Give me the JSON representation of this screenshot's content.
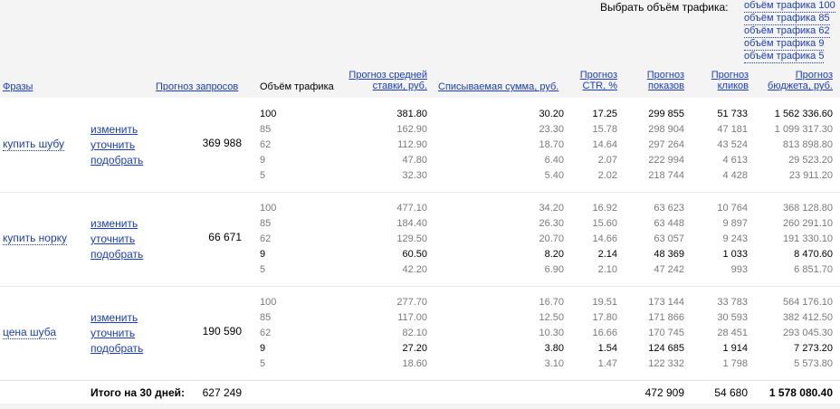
{
  "traffic_select": {
    "label": "Выбрать объём трафика:",
    "options": [
      "объём трафика 100",
      "объём трафика 85",
      "объём трафика 62",
      "объём трафика 9",
      "объём трафика 5"
    ]
  },
  "header": {
    "phrases": "Фразы",
    "requests": "Прогноз запросов",
    "volume": "Объём трафика",
    "bid_l1": "Прогноз средней",
    "bid_l2": "ставки, руб.",
    "charged": "Списываемая сумма, руб.",
    "ctr_l1": "Прогноз",
    "ctr_l2": "CTR, %",
    "impr_l1": "Прогноз",
    "impr_l2": "показов",
    "clicks_l1": "Прогноз",
    "clicks_l2": "кликов",
    "budget_l1": "Прогноз",
    "budget_l2": "бюджета, руб."
  },
  "actions": {
    "change": "изменить",
    "refine": "уточнить",
    "pick": "подобрать"
  },
  "phrases": [
    {
      "text": "купить шубу",
      "requests": "369 988",
      "rows": [
        {
          "vol": "100",
          "bid": "381.80",
          "charge": "30.20",
          "ctr": "17.25",
          "impr": "299 855",
          "clicks": "51 733",
          "budget": "1 562 336.60"
        },
        {
          "vol": "85",
          "bid": "162.90",
          "charge": "23.30",
          "ctr": "15.78",
          "impr": "298 904",
          "clicks": "47 181",
          "budget": "1 099 317.30"
        },
        {
          "vol": "62",
          "bid": "112.90",
          "charge": "18.70",
          "ctr": "14.64",
          "impr": "297 264",
          "clicks": "43 524",
          "budget": "813 898.80"
        },
        {
          "vol": "9",
          "bid": "47.80",
          "charge": "6.40",
          "ctr": "2.07",
          "impr": "222 994",
          "clicks": "4 613",
          "budget": "29 523.20"
        },
        {
          "vol": "5",
          "bid": "32.30",
          "charge": "5.40",
          "ctr": "2.02",
          "impr": "218 744",
          "clicks": "4 428",
          "budget": "23 911.20"
        }
      ]
    },
    {
      "text": "купить норку",
      "requests": "66 671",
      "rows": [
        {
          "vol": "100",
          "bid": "477.10",
          "charge": "34.20",
          "ctr": "16.92",
          "impr": "63 623",
          "clicks": "10 764",
          "budget": "368 128.80"
        },
        {
          "vol": "85",
          "bid": "184.40",
          "charge": "26.30",
          "ctr": "15.60",
          "impr": "63 448",
          "clicks": "9 897",
          "budget": "260 291.10"
        },
        {
          "vol": "62",
          "bid": "129.50",
          "charge": "20.70",
          "ctr": "14.66",
          "impr": "63 057",
          "clicks": "9 243",
          "budget": "191 330.10"
        },
        {
          "vol": "9",
          "bid": "60.50",
          "charge": "8.20",
          "ctr": "2.14",
          "impr": "48 369",
          "clicks": "1 033",
          "budget": "8 470.60"
        },
        {
          "vol": "5",
          "bid": "42.20",
          "charge": "6.90",
          "ctr": "2.10",
          "impr": "47 242",
          "clicks": "993",
          "budget": "6 851.70"
        }
      ]
    },
    {
      "text": "цена шуба",
      "requests": "190 590",
      "rows": [
        {
          "vol": "100",
          "bid": "277.70",
          "charge": "16.70",
          "ctr": "19.51",
          "impr": "173 144",
          "clicks": "33 783",
          "budget": "564 176.10"
        },
        {
          "vol": "85",
          "bid": "117.00",
          "charge": "12.50",
          "ctr": "17.80",
          "impr": "171 866",
          "clicks": "30 593",
          "budget": "382 412.50"
        },
        {
          "vol": "62",
          "bid": "82.10",
          "charge": "10.30",
          "ctr": "16.66",
          "impr": "170 745",
          "clicks": "28 451",
          "budget": "293 045.30"
        },
        {
          "vol": "9",
          "bid": "27.20",
          "charge": "3.80",
          "ctr": "1.54",
          "impr": "124 685",
          "clicks": "1 914",
          "budget": "7 273.20"
        },
        {
          "vol": "5",
          "bid": "18.60",
          "charge": "3.10",
          "ctr": "1.47",
          "impr": "122 332",
          "clicks": "1 798",
          "budget": "5 573.80"
        }
      ]
    }
  ],
  "footer": {
    "label": "Итого на 30 дней:",
    "requests": "627 249",
    "impr": "472 909",
    "clicks": "54 680",
    "budget": "1 578 080.40"
  }
}
